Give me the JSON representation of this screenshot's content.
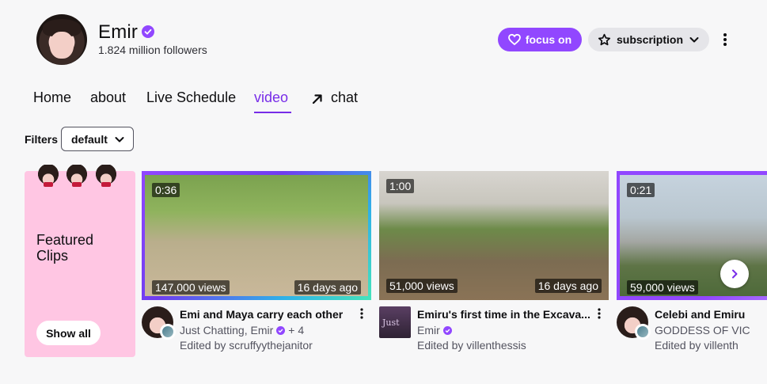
{
  "channel": {
    "name": "Emir",
    "followers": "1.824 million followers"
  },
  "header_actions": {
    "focus_label": "focus on",
    "subscription_label": "subscription"
  },
  "tabs": [
    {
      "label": "Home",
      "active": false
    },
    {
      "label": "about",
      "active": false
    },
    {
      "label": "Live Schedule",
      "active": false
    },
    {
      "label": "video",
      "active": true
    },
    {
      "label": "chat",
      "active": false
    }
  ],
  "filters": {
    "label": "Filters",
    "selected": "default"
  },
  "featured": {
    "title": "Featured Clips",
    "show_all_label": "Show all"
  },
  "clips": [
    {
      "duration": "0:36",
      "views": "147,000 views",
      "date": "16 days ago",
      "title": "Emi and Maya carry each other",
      "category": "Just Chatting, Emir",
      "extra": "+ 4",
      "editor": "Edited by scruffyythejanitor"
    },
    {
      "duration": "1:00",
      "views": "51,000 views",
      "date": "16 days ago",
      "title": "Emiru's first time in the Excava...",
      "category": "Emir",
      "extra": "",
      "editor": "Edited by villenthessis"
    },
    {
      "duration": "0:21",
      "views": "59,000 views",
      "date": "",
      "title": "Celebi and Emiru",
      "category": "GODDESS OF VIC",
      "extra": "",
      "editor": "Edited by villenth"
    }
  ],
  "colors": {
    "accent": "#9147ff",
    "accent_text": "#772ce8",
    "featured_bg": "#ffc6e3"
  }
}
